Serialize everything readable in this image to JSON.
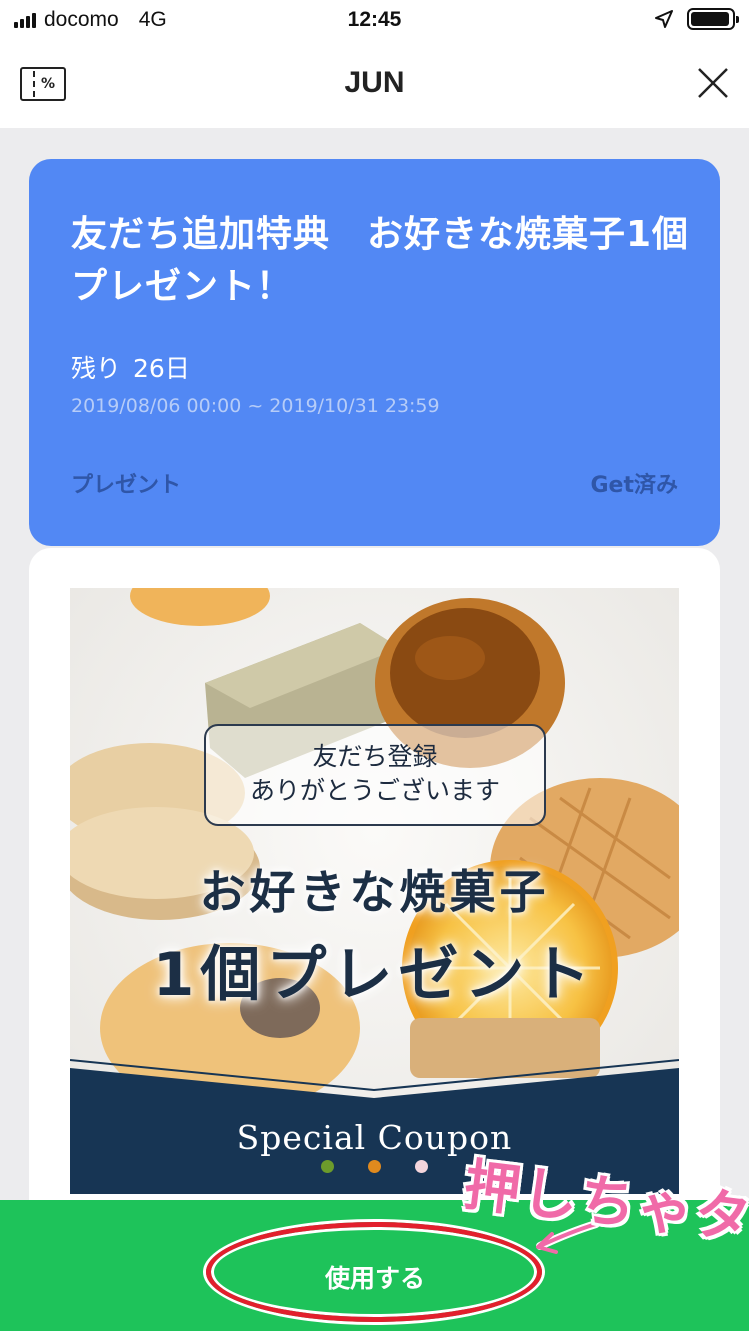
{
  "status_bar": {
    "carrier": "docomo",
    "network": "4G",
    "time": "12:45",
    "battery_level": 0.95
  },
  "nav": {
    "title": "JUN",
    "coupon_icon_text": "%",
    "icons": [
      "coupon-icon",
      "close-icon"
    ]
  },
  "coupon": {
    "title": "友だち追加特典　お好きな焼菓子1個プレゼント！",
    "remaining_label": "残り",
    "remaining_days": "26日",
    "period": "2019/08/06 00:00 ~ 2019/10/31 23:59",
    "category": "プレゼント",
    "status": "Get済み",
    "card_color": "#5288f4"
  },
  "image": {
    "thanks_line1": "友だち登録",
    "thanks_line2": "ありがとうございます",
    "headline1": "お好きな焼菓子",
    "headline2": "1個プレゼント",
    "special": "Special Coupon",
    "dot_colors": [
      "#6c9b2b",
      "#e08a1e",
      "#f4d5dc"
    ]
  },
  "action": {
    "use_label": "使用する",
    "bar_color": "#1ec35a"
  },
  "annotation": {
    "text": "押しちゃタ",
    "color": "#f06aa8",
    "ring_color": "#e21f2d"
  }
}
